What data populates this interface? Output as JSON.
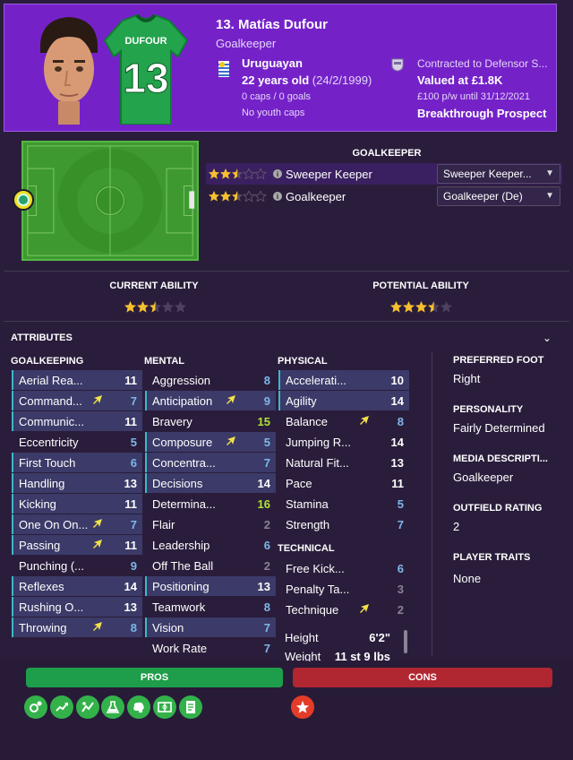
{
  "header": {
    "name": "13. Matías Dufour",
    "position": "Goalkeeper",
    "nationality": "Uruguayan",
    "age": "22 years old",
    "dob": "(24/2/1999)",
    "caps": "0 caps / 0 goals",
    "youth_caps": "No youth caps",
    "contract": "Contracted to Defensor S...",
    "value": "Valued at £1.8K",
    "wage": "£100 p/w until 31/12/2021",
    "prospect": "Breakthrough Prospect",
    "shirt_name": "DUFOUR",
    "shirt_number": "13"
  },
  "roles": {
    "title": "GOALKEEPER",
    "items": [
      {
        "name": "Sweeper Keeper",
        "rating": 2.5,
        "select": "Sweeper Keeper..."
      },
      {
        "name": "Goalkeeper",
        "rating": 2.5,
        "select": "Goalkeeper (De)"
      }
    ]
  },
  "ability": {
    "current_label": "CURRENT ABILITY",
    "current_stars": 2.5,
    "potential_label": "POTENTIAL ABILITY",
    "potential_stars": 3.5
  },
  "attributes": {
    "title": "ATTRIBUTES",
    "goalkeeping_title": "GOALKEEPING",
    "mental_title": "MENTAL",
    "physical_title": "PHYSICAL",
    "technical_title": "TECHNICAL",
    "goalkeeping": [
      {
        "name": "Aerial Rea...",
        "value": "11",
        "hl": true,
        "arrow": false,
        "color": "white"
      },
      {
        "name": "Command...",
        "value": "7",
        "hl": true,
        "arrow": true,
        "color": "blue"
      },
      {
        "name": "Communic...",
        "value": "11",
        "hl": true,
        "arrow": false,
        "color": "white"
      },
      {
        "name": "Eccentricity",
        "value": "5",
        "hl": false,
        "arrow": false,
        "color": "blue"
      },
      {
        "name": "First Touch",
        "value": "6",
        "hl": true,
        "arrow": false,
        "color": "blue"
      },
      {
        "name": "Handling",
        "value": "13",
        "hl": true,
        "arrow": false,
        "color": "white"
      },
      {
        "name": "Kicking",
        "value": "11",
        "hl": true,
        "arrow": false,
        "color": "white"
      },
      {
        "name": "One On On...",
        "value": "7",
        "hl": true,
        "arrow": true,
        "color": "blue"
      },
      {
        "name": "Passing",
        "value": "11",
        "hl": true,
        "arrow": true,
        "color": "white"
      },
      {
        "name": "Punching (...",
        "value": "9",
        "hl": false,
        "arrow": false,
        "color": "blue"
      },
      {
        "name": "Reflexes",
        "value": "14",
        "hl": true,
        "arrow": false,
        "color": "white"
      },
      {
        "name": "Rushing O...",
        "value": "13",
        "hl": true,
        "arrow": false,
        "color": "white"
      },
      {
        "name": "Throwing",
        "value": "8",
        "hl": true,
        "arrow": true,
        "color": "blue"
      }
    ],
    "mental": [
      {
        "name": "Aggression",
        "value": "8",
        "hl": false,
        "arrow": false,
        "color": "blue"
      },
      {
        "name": "Anticipation",
        "value": "9",
        "hl": true,
        "arrow": true,
        "color": "blue"
      },
      {
        "name": "Bravery",
        "value": "15",
        "hl": false,
        "arrow": false,
        "color": "green"
      },
      {
        "name": "Composure",
        "value": "5",
        "hl": true,
        "arrow": true,
        "color": "blue"
      },
      {
        "name": "Concentra...",
        "value": "7",
        "hl": true,
        "arrow": false,
        "color": "blue"
      },
      {
        "name": "Decisions",
        "value": "14",
        "hl": true,
        "arrow": false,
        "color": "white"
      },
      {
        "name": "Determina...",
        "value": "16",
        "hl": false,
        "arrow": false,
        "color": "green"
      },
      {
        "name": "Flair",
        "value": "2",
        "hl": false,
        "arrow": false,
        "color": "grey"
      },
      {
        "name": "Leadership",
        "value": "6",
        "hl": false,
        "arrow": false,
        "color": "blue"
      },
      {
        "name": "Off The Ball",
        "value": "2",
        "hl": false,
        "arrow": false,
        "color": "grey"
      },
      {
        "name": "Positioning",
        "value": "13",
        "hl": true,
        "arrow": false,
        "color": "white"
      },
      {
        "name": "Teamwork",
        "value": "8",
        "hl": false,
        "arrow": false,
        "color": "blue"
      },
      {
        "name": "Vision",
        "value": "7",
        "hl": true,
        "arrow": false,
        "color": "blue"
      },
      {
        "name": "Work Rate",
        "value": "7",
        "hl": false,
        "arrow": false,
        "color": "blue"
      }
    ],
    "physical": [
      {
        "name": "Accelerati...",
        "value": "10",
        "hl": true,
        "arrow": false,
        "color": "white"
      },
      {
        "name": "Agility",
        "value": "14",
        "hl": true,
        "arrow": false,
        "color": "white"
      },
      {
        "name": "Balance",
        "value": "8",
        "hl": false,
        "arrow": true,
        "color": "blue"
      },
      {
        "name": "Jumping R...",
        "value": "14",
        "hl": false,
        "arrow": false,
        "color": "white"
      },
      {
        "name": "Natural Fit...",
        "value": "13",
        "hl": false,
        "arrow": false,
        "color": "white"
      },
      {
        "name": "Pace",
        "value": "11",
        "hl": false,
        "arrow": false,
        "color": "white"
      },
      {
        "name": "Stamina",
        "value": "5",
        "hl": false,
        "arrow": false,
        "color": "blue"
      },
      {
        "name": "Strength",
        "value": "7",
        "hl": false,
        "arrow": false,
        "color": "blue"
      }
    ],
    "technical": [
      {
        "name": "Free Kick...",
        "value": "6",
        "hl": false,
        "arrow": false,
        "color": "blue"
      },
      {
        "name": "Penalty Ta...",
        "value": "3",
        "hl": false,
        "arrow": false,
        "color": "grey"
      },
      {
        "name": "Technique",
        "value": "2",
        "hl": false,
        "arrow": true,
        "color": "grey"
      }
    ],
    "height_label": "Height",
    "height_value": "6'2\"",
    "weight_label": "Weight",
    "weight_value": "11 st 9 lbs"
  },
  "info": {
    "foot_label": "PREFERRED FOOT",
    "foot_value": "Right",
    "personality_label": "PERSONALITY",
    "personality_value": "Fairly Determined",
    "media_label": "MEDIA DESCRIPTI...",
    "media_value": "Goalkeeper",
    "outfield_label": "OUTFIELD RATING",
    "outfield_value": "2",
    "traits_label": "PLAYER TRAITS",
    "traits_value": "None"
  },
  "pros_cons": {
    "pros_label": "PROS",
    "cons_label": "CONS",
    "pros_icons": [
      "gk-distribution-icon",
      "trend-up-icon",
      "improving-icon",
      "flask-icon",
      "brain-icon",
      "pitch-icon",
      "document-icon"
    ],
    "cons_icons": [
      "star-icon"
    ]
  },
  "colors": {
    "header_bg": "#7422c8",
    "page_bg": "#2a1d3b",
    "pros": "#1e9d4a",
    "cons": "#b02631",
    "star": "#f6c02e"
  }
}
